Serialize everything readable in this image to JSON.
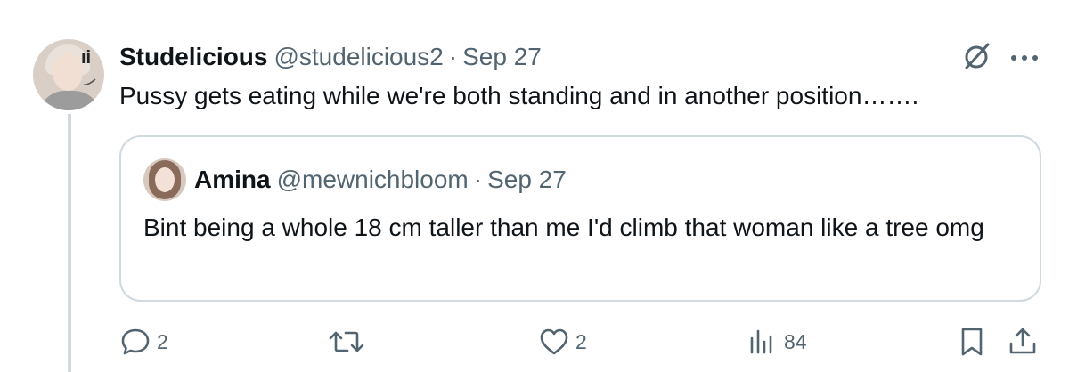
{
  "tweet": {
    "author_name": "Studelicious",
    "author_handle": "@studelicious2",
    "separator": "·",
    "date": "Sep 27",
    "avatar_deco": "ıi",
    "text": "Pussy gets eating while we're both standing and in another position……."
  },
  "quoted_tweet": {
    "author_name": "Amina",
    "author_handle": "@mewnichbloom",
    "separator": "·",
    "date": "Sep 27",
    "text": "Bint being a whole 18 cm taller than me I'd climb that woman like a tree omg"
  },
  "actions": {
    "replies": "2",
    "likes": "2",
    "views": "84"
  },
  "icons": {
    "reply": "reply-icon",
    "retweet": "retweet-icon",
    "like": "like-icon",
    "views": "views-icon",
    "bookmark": "bookmark-icon",
    "share": "share-icon",
    "grok": "grok-icon",
    "more": "more-icon"
  },
  "colors": {
    "text": "#0f1419",
    "secondary": "#536471",
    "border": "#cfd9de"
  }
}
